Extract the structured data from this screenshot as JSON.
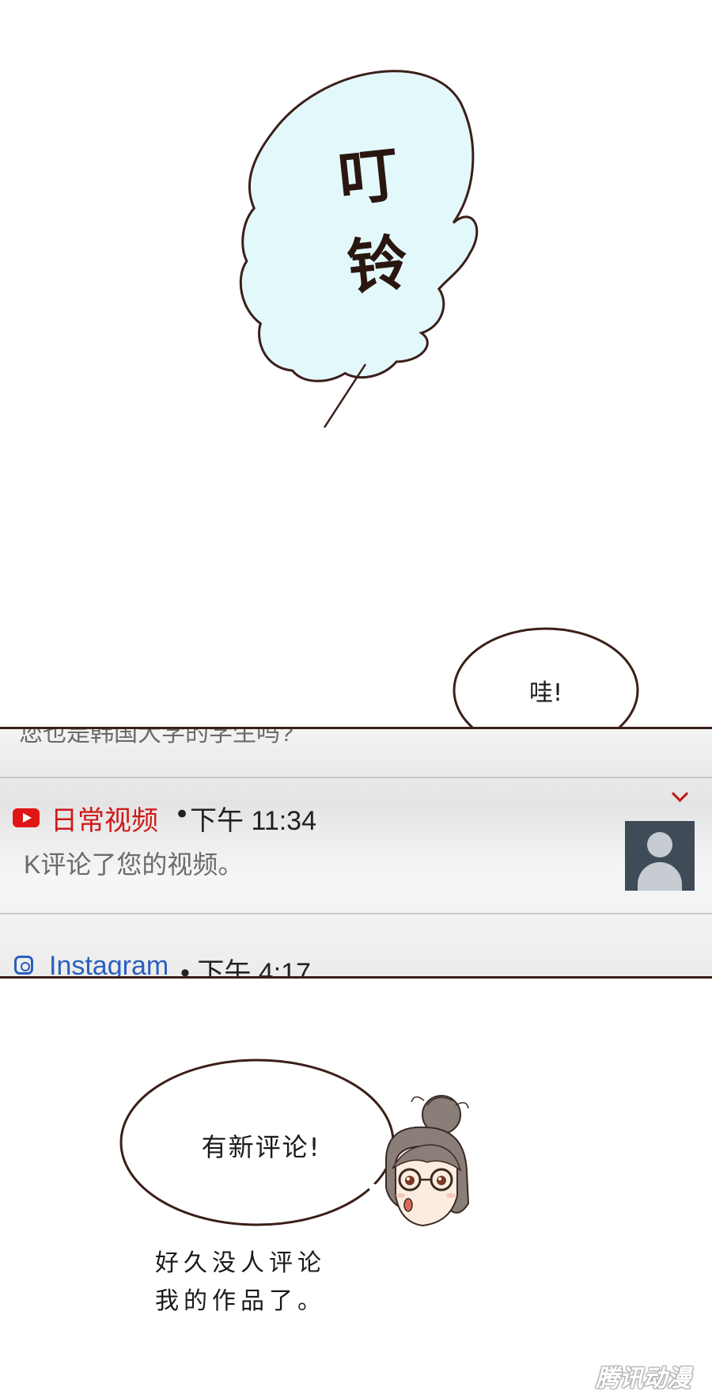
{
  "sfx": {
    "line1": "叮",
    "line2": "铃"
  },
  "bubbles": {
    "wah": "哇!",
    "new_comment": "有新评论!"
  },
  "notification_panel": {
    "clipped_top_text": "您也是韩国大学的学生吗?",
    "youtube": {
      "icon": "youtube-icon",
      "app_name": "日常视频",
      "bullet": "•",
      "time": "下午 11:34",
      "message": "K评论了您的视频。"
    },
    "instagram": {
      "icon": "instagram-icon",
      "app_name": "Instagram",
      "time": "• 下午 4:17"
    }
  },
  "caption": {
    "line1": "好久没人评论",
    "line2": "我的作品了。"
  },
  "watermark": "腾讯动漫",
  "colors": {
    "sfx_bubble_fill": "#e3f8fb",
    "outline": "#3a1f18",
    "youtube_red": "#d01818",
    "instagram_blue": "#2a5fbf"
  }
}
